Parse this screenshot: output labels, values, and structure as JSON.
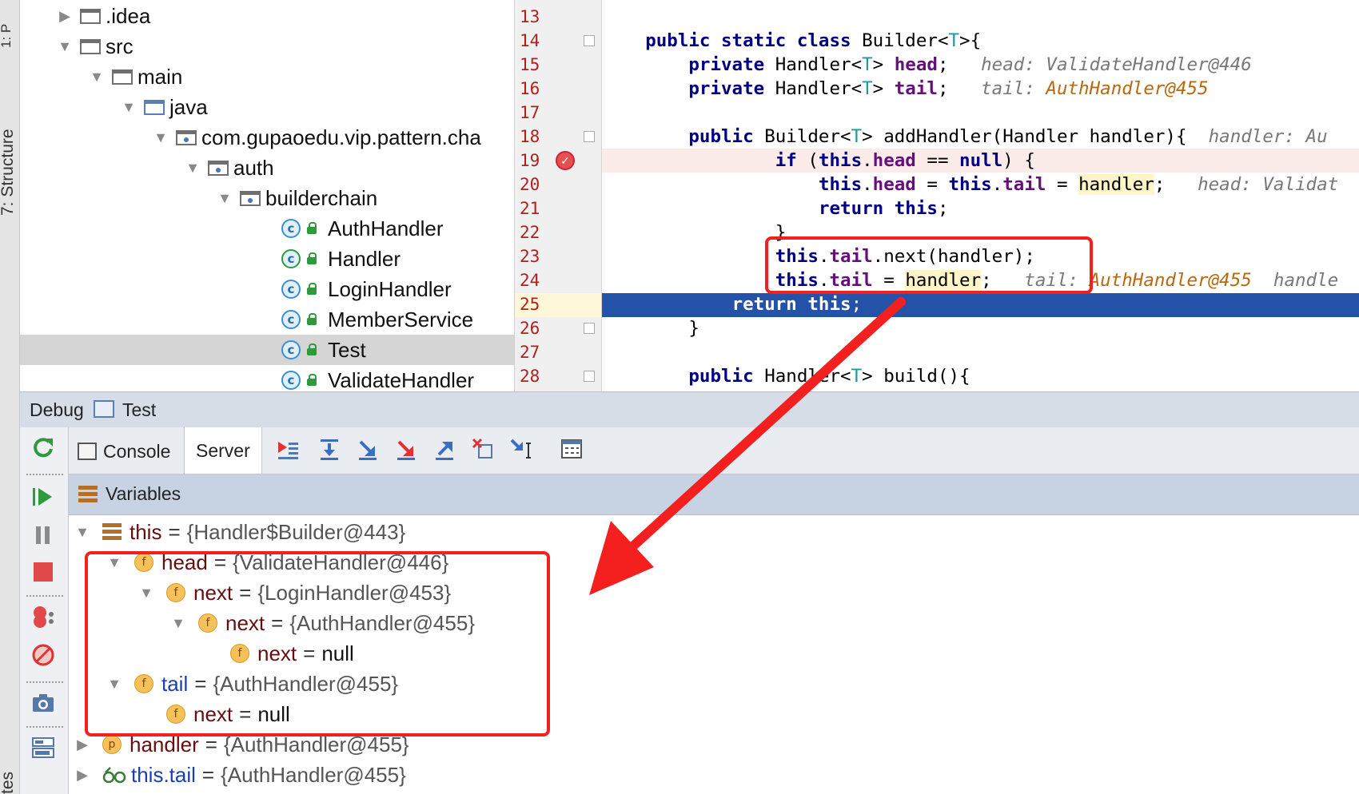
{
  "sidebar": {
    "top_label": "1: P",
    "structure_label": "7: Structure",
    "bottom_label": "tes"
  },
  "project_tree": {
    "items": [
      {
        "label": ".idea",
        "kind": "folder",
        "expanded": false
      },
      {
        "label": "src",
        "kind": "folder",
        "expanded": true
      },
      {
        "label": "main",
        "kind": "folder",
        "expanded": true
      },
      {
        "label": "java",
        "kind": "source-folder",
        "expanded": true
      },
      {
        "label": "com.gupaoedu.vip.pattern.cha",
        "kind": "package",
        "expanded": true
      },
      {
        "label": "auth",
        "kind": "package",
        "expanded": true
      },
      {
        "label": "builderchain",
        "kind": "package",
        "expanded": true
      },
      {
        "label": "AuthHandler",
        "kind": "class"
      },
      {
        "label": "Handler",
        "kind": "abstract-class"
      },
      {
        "label": "LoginHandler",
        "kind": "class"
      },
      {
        "label": "MemberService",
        "kind": "class"
      },
      {
        "label": "Test",
        "kind": "runnable-class",
        "selected": true
      },
      {
        "label": "ValidateHandler",
        "kind": "class"
      }
    ]
  },
  "editor": {
    "line_numbers": [
      "13",
      "14",
      "15",
      "16",
      "17",
      "18",
      "19",
      "20",
      "21",
      "22",
      "23",
      "24",
      "25",
      "26",
      "27",
      "28"
    ],
    "current_line": "25",
    "breakpoint_line": "19",
    "lines": {
      "l14": {
        "k1": "public static class ",
        "n1": "Builder<",
        "t1": "T",
        "n2": ">{"
      },
      "l15": {
        "k1": "private ",
        "n1": "Handler<",
        "t1": "T",
        "n2": "> ",
        "f1": "head",
        "n3": ";",
        "h1": "head: ValidateHandler@446"
      },
      "l16": {
        "k1": "private ",
        "n1": "Handler<",
        "t1": "T",
        "n2": "> ",
        "f1": "tail",
        "n3": ";",
        "h1": "tail: ",
        "h2": "AuthHandler@455"
      },
      "l18": {
        "k1": "public ",
        "n1": "Builder<",
        "t1": "T",
        "n2": "> addHandler(Handler handler){",
        "h1": "handler: Au"
      },
      "l19": {
        "k1": "if ",
        "n1": "(",
        "k2": "this",
        "n2": ".",
        "f1": "head",
        "n3": " == ",
        "k3": "null",
        "n4": ") {"
      },
      "l20": {
        "k1": "this",
        "n1": ".",
        "f1": "head",
        "n2": " = ",
        "k2": "this",
        "n3": ".",
        "f2": "tail",
        "n4": " = ",
        "v1": "handler",
        "n5": ";",
        "h1": "head: Validat"
      },
      "l21": {
        "k1": "return this",
        "n1": ";"
      },
      "l22": {
        "n1": "}"
      },
      "l23": {
        "k1": "this",
        "n1": ".",
        "f1": "tail",
        "n2": ".next(handler);"
      },
      "l24": {
        "k1": "this",
        "n1": ".",
        "f1": "tail",
        "n2": " = ",
        "v1": "handler",
        "n3": ";",
        "h1": "tail: ",
        "h2": "AuthHandler@455",
        "h3": "handle"
      },
      "l25": {
        "k1": "return this",
        "n1": ";"
      },
      "l26": {
        "n1": "}"
      },
      "l28": {
        "k1": "public ",
        "n1": "Handler<",
        "t1": "T",
        "n2": "> build(){"
      }
    }
  },
  "debug": {
    "title": "Debug",
    "run_config": "Test",
    "tabs": {
      "console": "Console",
      "server": "Server"
    },
    "toolbar_icons": [
      "show-execution-point-icon",
      "step-over-icon",
      "step-into-icon",
      "force-step-into-icon",
      "step-out-icon",
      "drop-frame-icon",
      "run-to-cursor-icon",
      "evaluate-expression-icon"
    ],
    "side_icons": [
      "rerun-icon",
      "resume-icon",
      "pause-icon",
      "stop-icon",
      "view-breakpoints-icon",
      "mute-breakpoints-icon",
      "camera-icon",
      "layout-icon"
    ],
    "variables_title": "Variables",
    "variables": [
      {
        "name": "this",
        "value": "{Handler$Builder@443}"
      },
      {
        "name": "head",
        "value": "{ValidateHandler@446}"
      },
      {
        "name": "next",
        "value": "{LoginHandler@453}"
      },
      {
        "name": "next",
        "value": "{AuthHandler@455}"
      },
      {
        "name": "next",
        "value": "null"
      },
      {
        "name": "tail",
        "value": "{AuthHandler@455}"
      },
      {
        "name": "next",
        "value": "null"
      },
      {
        "name": "handler",
        "value": "{AuthHandler@455}"
      },
      {
        "name": "this.tail",
        "value": "{AuthHandler@455}"
      }
    ],
    "eq": "="
  },
  "colors": {
    "annotation_red": "#f41f1f",
    "current_line_blue": "#2452a8"
  }
}
